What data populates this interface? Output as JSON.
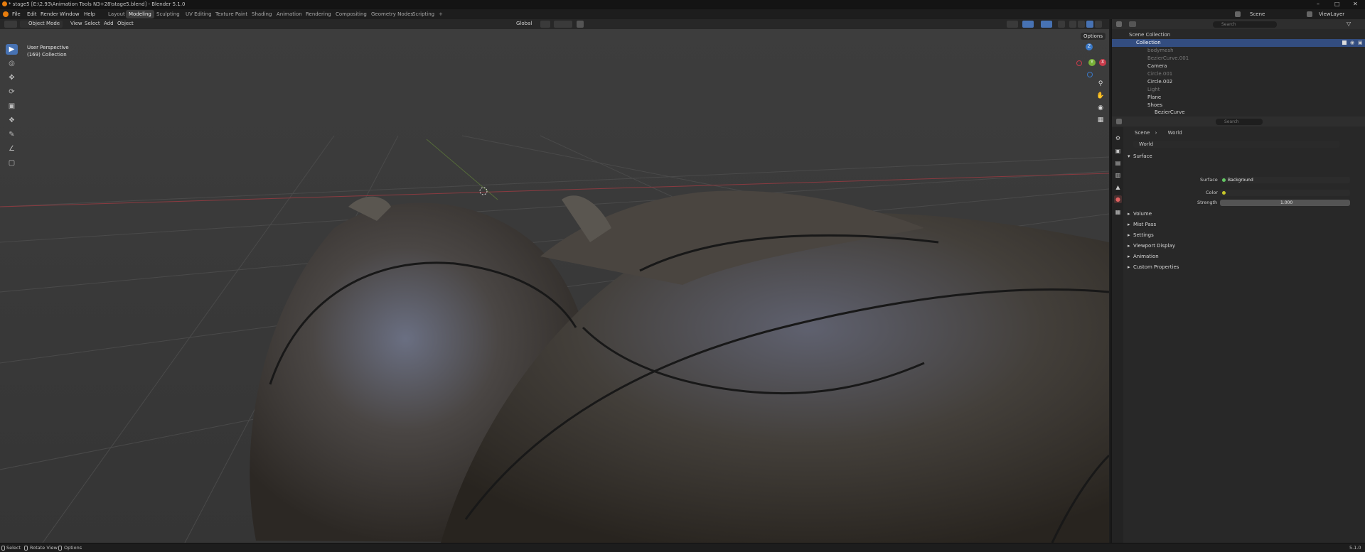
{
  "window": {
    "title": "* stage5 [E:\\2.93\\Animation Tools N3+28\\stage5.blend] - Blender 5.1.0",
    "min_icon": "minimize-icon",
    "max_icon": "maximize-icon",
    "close_icon": "close-icon"
  },
  "menu": {
    "items": [
      "File",
      "Edit",
      "Render",
      "Window",
      "Help"
    ],
    "workspaces": [
      "Layout",
      "Modeling",
      "Sculpting",
      "UV Editing",
      "Texture Paint",
      "Shading",
      "Animation",
      "Rendering",
      "Compositing",
      "Geometry Nodes",
      "Scripting"
    ],
    "active_workspace": "Modeling",
    "add_tab": "+",
    "scene_label": "Scene",
    "viewlayer_label": "ViewLayer"
  },
  "header": {
    "mode": "Object Mode",
    "menus": [
      "View",
      "Select",
      "Add",
      "Object"
    ],
    "orientation": "Global",
    "options": "Options"
  },
  "viewport": {
    "perspective": "User Perspective",
    "collection_info": "(169) Collection",
    "axes": {
      "x": "X",
      "y": "Y",
      "z": "Z"
    }
  },
  "outliner": {
    "search_placeholder": "Search",
    "root": "Scene Collection",
    "collection": "Collection",
    "items": [
      {
        "name": "bodymesh",
        "dim": true
      },
      {
        "name": "BezierCurve.001",
        "dim": true
      },
      {
        "name": "Camera",
        "dim": false
      },
      {
        "name": "Circle.001",
        "dim": true
      },
      {
        "name": "Circle.002",
        "dim": false
      },
      {
        "name": "Light",
        "dim": true
      },
      {
        "name": "Plane",
        "dim": false
      },
      {
        "name": "Shoes",
        "dim": false
      },
      {
        "name": "BezierCurve",
        "dim": false
      }
    ]
  },
  "properties": {
    "search_placeholder": "Search",
    "breadcrumb": [
      "Scene",
      "World"
    ],
    "world_name": "World",
    "sections": {
      "surface": "Surface",
      "surface_label": "Surface",
      "surface_value": "Background",
      "color_label": "Color",
      "strength_label": "Strength",
      "strength_value": "1.000",
      "collapsed": [
        "Volume",
        "Mist Pass",
        "Settings",
        "Viewport Display",
        "Animation",
        "Custom Properties"
      ]
    }
  },
  "status": {
    "select": "Select",
    "rotate": "Rotate View",
    "options": "Options",
    "version": "5.1.0"
  },
  "colors": {
    "accent": "#4772b3",
    "x_axis": "#c93b4b",
    "y_axis": "#78b038",
    "z_axis": "#3a78c7"
  }
}
